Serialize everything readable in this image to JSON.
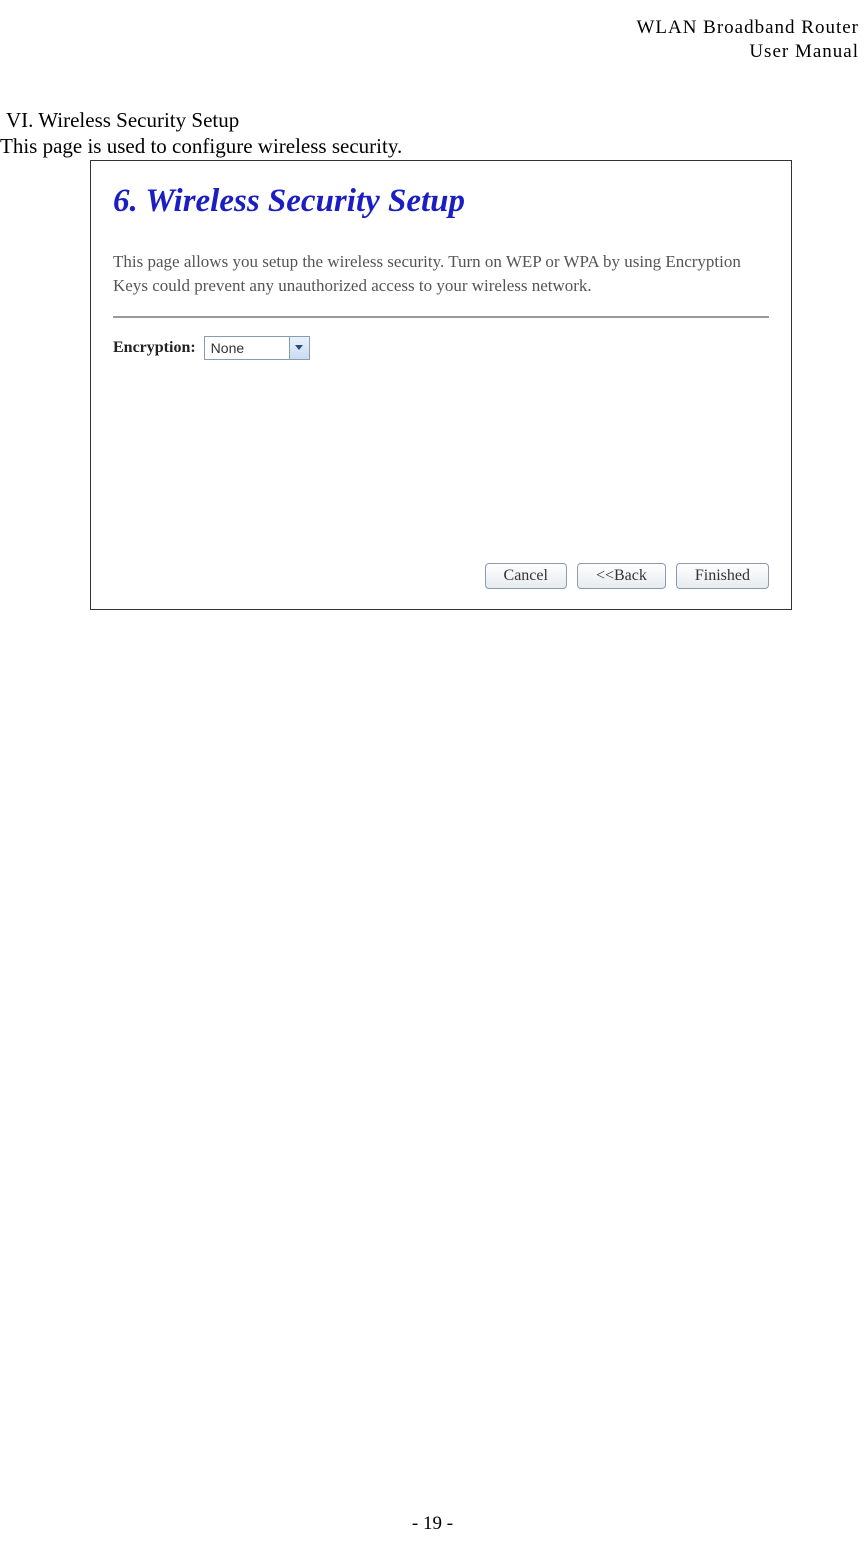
{
  "header": {
    "line1": "WLAN  Broadband  Router",
    "line2": "User  Manual"
  },
  "section": {
    "heading": "VI. Wireless Security Setup",
    "desc": "This page is used to configure wireless security."
  },
  "panel": {
    "title": "6. Wireless Security Setup",
    "body": "This page allows you setup the wireless security. Turn on WEP or WPA by using Encryption Keys could prevent any unauthorized access to your wireless network.",
    "field_label": "Encryption:",
    "encryption_value": "None",
    "buttons": {
      "cancel": "Cancel",
      "back": "<<Back",
      "finished": "Finished"
    }
  },
  "footer": {
    "page": "- 19 -"
  }
}
